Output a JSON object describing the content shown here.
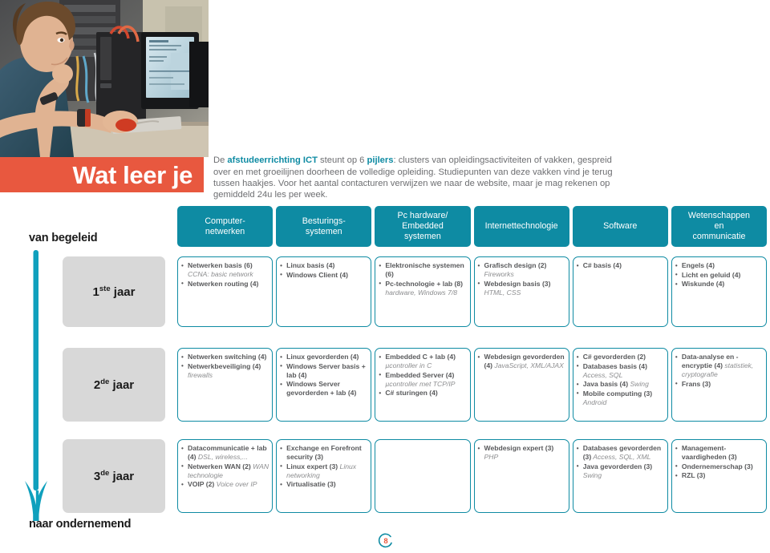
{
  "header": {
    "title": "Wat leer je",
    "photo_alt": "student-at-computer-photo"
  },
  "intro": {
    "line1_a": "De ",
    "line1_b": "afstudeerrichting ICT",
    "line1_c": " steunt op 6 ",
    "line1_d": "pijlers",
    "line1_e": ": clusters van opleidingsactiviteiten of vakken, gespreid over en met groeilijnen doorheen de volledige opleiding. Studiepunten van deze vakken vind je terug tussen haakjes. Voor het aantal contacturen verwijzen we naar de website, maar je mag rekenen op gemiddeld 24u les per week.",
    "full_text": "De afstudeerrichting ICT steunt op 6 pijlers: clusters van opleidingsactiviteiten of vakken, gespreid over en met groeilijnen doorheen de volledige opleiding. Studiepunten van deze vakken vind je terug tussen haakjes. Voor het aantal contacturen verwijzen we naar de website, maar je mag rekenen op gemiddeld 24u les per week."
  },
  "side_labels": {
    "top": "van begeleid",
    "bottom": "naar ondernemend"
  },
  "pillars": [
    {
      "label": "Computer-\nnetwerken"
    },
    {
      "label": "Besturings-\nsystemen"
    },
    {
      "label": "Pc hardware/\nEmbedded\nsystemen"
    },
    {
      "label": "Internettechnologie"
    },
    {
      "label": "Software"
    },
    {
      "label": "Wetenschappen\nen\ncommunicatie"
    }
  ],
  "years": [
    {
      "label_num": "1",
      "label_sup": "ste",
      "label_rest": "jaar",
      "columns": [
        {
          "items": [
            {
              "text": "Netwerken basis (6)",
              "note": "CCNA: basic network"
            },
            {
              "text": "Netwerken routing (4)",
              "note": ""
            }
          ]
        },
        {
          "items": [
            {
              "text": "Linux basis (4)",
              "note": ""
            },
            {
              "text": "Windows Client (4)",
              "note": ""
            }
          ]
        },
        {
          "items": [
            {
              "text": "Elektronische systemen (6)",
              "note": ""
            },
            {
              "text": "Pc-technologie + lab (8)",
              "note": "hardware, Windows 7/8"
            }
          ]
        },
        {
          "items": [
            {
              "text": "Grafisch design (2)",
              "note": "Fireworks"
            },
            {
              "text": "Webdesign basis (3)",
              "note": "HTML, CSS"
            }
          ]
        },
        {
          "items": [
            {
              "text": "C# basis (4)",
              "note": ""
            }
          ]
        },
        {
          "items": [
            {
              "text": "Engels (4)",
              "note": ""
            },
            {
              "text": "Licht en geluid (4)",
              "note": ""
            },
            {
              "text": "Wiskunde (4)",
              "note": ""
            }
          ]
        }
      ]
    },
    {
      "label_num": "2",
      "label_sup": "de",
      "label_rest": "jaar",
      "columns": [
        {
          "items": [
            {
              "text": "Netwerken switching (4)",
              "note": ""
            },
            {
              "text": "Netwerkbeveiliging (4)",
              "note": "firewalls"
            }
          ]
        },
        {
          "items": [
            {
              "text": "Linux gevorderden (4)",
              "note": ""
            },
            {
              "text": "Windows Server basis + lab (4)",
              "note": ""
            },
            {
              "text": "Windows Server gevorderden + lab (4)",
              "note": ""
            }
          ]
        },
        {
          "items": [
            {
              "text": "Embedded C + lab (4)",
              "note": "µcontroller in C"
            },
            {
              "text": "Embedded Server (4)",
              "note": "µcontroller met TCP/IP"
            },
            {
              "text": "C# sturingen (4)",
              "note": ""
            }
          ]
        },
        {
          "items": [
            {
              "text": "Webdesign gevorderden (4)",
              "note": "JavaScript, XML/AJAX"
            }
          ]
        },
        {
          "items": [
            {
              "text": "C# gevorderden (2)",
              "note": ""
            },
            {
              "text": "Databases basis (4)",
              "note": "Access, SQL"
            },
            {
              "text": "Java basis (4)",
              "note": "Swing"
            },
            {
              "text": "Mobile computing (3)",
              "note": "Android"
            }
          ]
        },
        {
          "items": [
            {
              "text": "Data-analyse en -encryptie (4)",
              "note": "statistiek, cryptografie"
            },
            {
              "text": "Frans (3)",
              "note": ""
            }
          ]
        }
      ]
    },
    {
      "label_num": "3",
      "label_sup": "de",
      "label_rest": "jaar",
      "columns": [
        {
          "items": [
            {
              "text": "Datacommunicatie + lab (4)",
              "note": "DSL, wireless,..."
            },
            {
              "text": "Netwerken WAN (2)",
              "note": "WAN technologie"
            },
            {
              "text": "VOIP (2)",
              "note": "Voice over IP"
            }
          ]
        },
        {
          "items": [
            {
              "text": "Exchange en Forefront security (3)",
              "note": ""
            },
            {
              "text": "Linux expert (3)",
              "note": "Linux networking"
            },
            {
              "text": "Virtualisatie (3)",
              "note": ""
            }
          ]
        },
        {
          "items": []
        },
        {
          "items": [
            {
              "text": "Webdesign expert (3)",
              "note": "PHP"
            }
          ]
        },
        {
          "items": [
            {
              "text": "Databases gevorderden (3)",
              "note": "Access, SQL, XML"
            },
            {
              "text": "Java gevorderden (3)",
              "note": "Swing"
            }
          ]
        },
        {
          "items": [
            {
              "text": "Management-vaardigheden (3)",
              "note": ""
            },
            {
              "text": "Ondernemerschap (3)",
              "note": ""
            },
            {
              "text": "RZL (3)",
              "note": ""
            }
          ]
        }
      ]
    }
  ],
  "page_number": "8",
  "colors": {
    "teal": "#0e8ba3",
    "red": "#e8583f",
    "grey_box": "#d8d8d8",
    "body_text": "#58595b",
    "note_text": "#8c8d8f"
  }
}
